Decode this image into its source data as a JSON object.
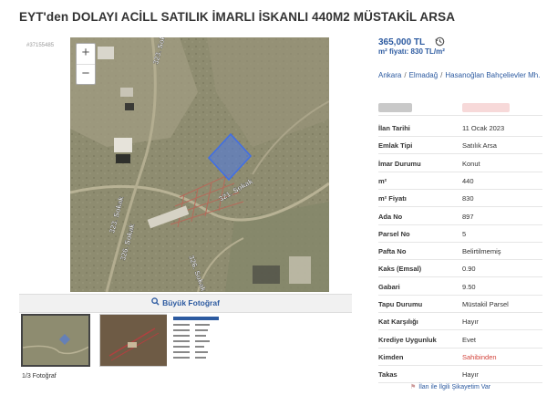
{
  "title": "EYT'den DOLAYI ACİLL SATILIK İMARLI İSKANLI 440M2 MÜSTAKİL ARSA",
  "gallery": {
    "listing_tag": "#37155485",
    "zoom_in": "+",
    "zoom_out": "−",
    "map_labels": [
      "323. Sokak",
      "321. Sokak",
      "323. Sokak",
      "326. Sokak",
      "326. Sokak"
    ],
    "big_photo_label": "Büyük Fotoğraf",
    "photo_count": "1/3 Fotoğraf"
  },
  "price": {
    "value": "365,000 TL",
    "m2_price": "m² fiyatı: 830 TL/m²"
  },
  "location": {
    "city": "Ankara",
    "district": "Elmadağ",
    "neighborhood": "Hasanoğlan Bahçelievler Mh."
  },
  "details": [
    {
      "key": "İlan Tarihi",
      "value": "11 Ocak 2023"
    },
    {
      "key": "Emlak Tipi",
      "value": "Satılık Arsa"
    },
    {
      "key": "İmar Durumu",
      "value": "Konut"
    },
    {
      "key": "m²",
      "value": "440"
    },
    {
      "key": "m² Fiyatı",
      "value": "830"
    },
    {
      "key": "Ada No",
      "value": "897"
    },
    {
      "key": "Parsel No",
      "value": "5"
    },
    {
      "key": "Pafta No",
      "value": "Belirtilmemiş"
    },
    {
      "key": "Kaks (Emsal)",
      "value": "0.90"
    },
    {
      "key": "Gabari",
      "value": "9.50"
    },
    {
      "key": "Tapu Durumu",
      "value": "Müstakil Parsel"
    },
    {
      "key": "Kat Karşılığı",
      "value": "Hayır"
    },
    {
      "key": "Krediye Uygunluk",
      "value": "Evet"
    },
    {
      "key": "Kimden",
      "value": "Sahibinden"
    },
    {
      "key": "Takas",
      "value": "Hayır"
    }
  ],
  "report_link": "İlan ile İlgili Şikayetim Var",
  "colors": {
    "link_blue": "#2c5aa0",
    "owner_red": "#d3443c",
    "parcel_highlight": "#3f6ee8"
  }
}
